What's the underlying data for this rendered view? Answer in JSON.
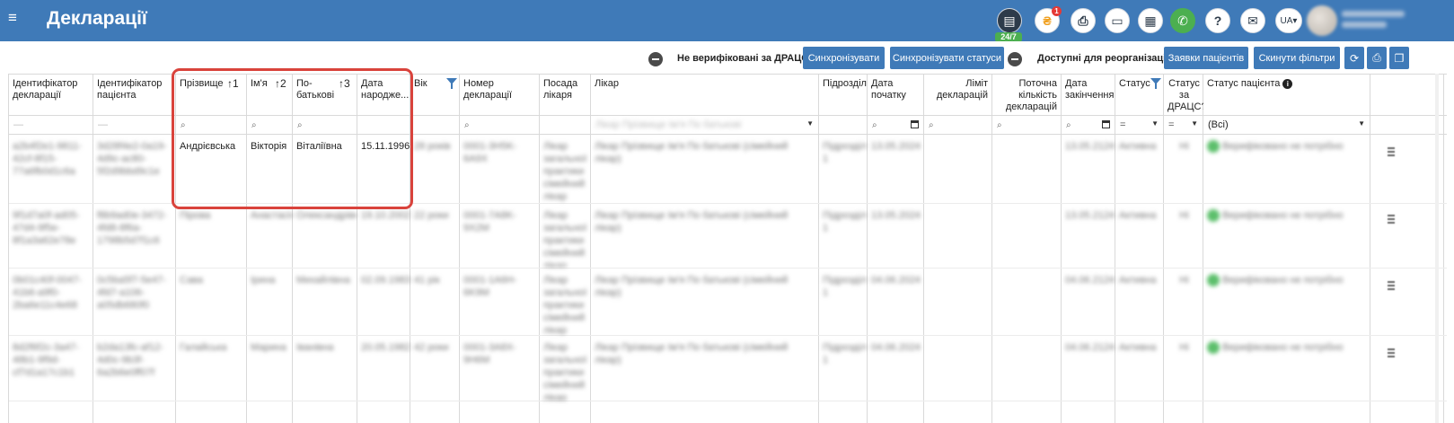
{
  "header": {
    "menu_icon": "hamburger-icon",
    "title": "Декларації",
    "chat_badge": "24/7",
    "notif_badge": "1",
    "lang": "UA▾",
    "icons": [
      "chat-icon",
      "notification-icon",
      "pdf-icon",
      "card-icon",
      "calculator-icon",
      "phone-icon",
      "help-icon",
      "megaphone-icon"
    ]
  },
  "toolbar": {
    "not_verified_label": "Не верифіковані за ДРАЦС",
    "sync_btn": "Синхронізувати",
    "sync_status_btn": "Синхронізувати статуси",
    "reorg_label": "Доступні для реорганізації",
    "requests_btn": "Заявки пацієнтів",
    "reset_filters_btn": "Скинути фільтри",
    "icons": [
      "refresh-icon",
      "print-icon",
      "copy-icon"
    ]
  },
  "columns": {
    "decl_id": "Ідентифікатор декларації",
    "patient_id": "Ідентифікатор пацієнта",
    "surname": "Прізвище",
    "surname_sort": "↑1",
    "name": "Ім'я",
    "name_sort": "↑2",
    "patronymic": "По-батькові",
    "patronymic_sort": "↑3",
    "birth_date": "Дата народже...",
    "age": "Вік",
    "decl_number": "Номер декларації",
    "doctor_position": "Посада лікаря",
    "doctor": "Лікар",
    "division": "Підрозділ",
    "start_date": "Дата початку",
    "decl_limit": "Ліміт декларацій",
    "current_count": "Поточна кількість декларацій",
    "end_date": "Дата закінчення",
    "status": "Статус",
    "dracs_status": "Статус за ДРАЦС?",
    "patient_status": "Статус пацієнта"
  },
  "filters": {
    "search_mark": "⌕",
    "eq": "=",
    "all": "(Всі)",
    "doctor_placeholder": "Лікар Прізвище Ім'я По батькові"
  },
  "rows": [
    {
      "decl_id": "a2b4f2e1-9811-42cf-8f15-77a6fb0d1c6a",
      "patient_id": "3d28f4e2-0a19-4d9c-ac80-5f2d9bbd9c1e",
      "surname": "Андрієвська",
      "name": "Вікторія",
      "patronymic": "Віталіївна",
      "birth_date": "15.11.1996",
      "age": "28 років",
      "decl_number": "0001-3H5K-6A9X",
      "doctor_position": "Лікар загальної практики сімейний лікар",
      "doctor": "Лікар Прізвище Ім'я По батькові (сімейний лікар)",
      "division": "Підрозділ 1",
      "start_date": "13.05.2024",
      "end_date": "13.05.2124",
      "status": "Активна",
      "dracs": "Ні",
      "patient_status": "Верифіковано не потрібно"
    },
    {
      "decl_id": "9f1d7a0f-ad05-47d4-9f5e-8f1a3a62e78e",
      "patient_id": "f8b9ad0e-3472-4fd8-8f6a-1798b5d7f1c6",
      "surname": "Пірова",
      "name": "Анастасія",
      "patronymic": "Олександрівна",
      "birth_date": "19.10.2002",
      "age": "22 роки",
      "decl_number": "0001-7A8K-9X2M",
      "doctor_position": "Лікар загальної практики сімейний лікар",
      "doctor": "Лікар Прізвище Ім'я По батькові (сімейний лікар)",
      "division": "Підрозділ 1",
      "start_date": "13.05.2024",
      "end_date": "13.05.2124",
      "status": "Активна",
      "dracs": "Ні",
      "patient_status": "Верифіковано не потрібно"
    },
    {
      "decl_id": "0b01c40f-0047-41b6-a9f0-2ba6e11c4e68",
      "patient_id": "0c5ba5f7-5e47-4fd7-a106-a05db680f0",
      "surname": "Сава",
      "name": "Ірина",
      "patronymic": "Михайлівна",
      "birth_date": "02.09.1983",
      "age": "41 рік",
      "decl_number": "0001-1A6H-6K9M",
      "doctor_position": "Лікар загальної практики сімейний лікар",
      "doctor": "Лікар Прізвище Ім'я По батькові (сімейний лікар)",
      "division": "Підрозділ 1",
      "start_date": "04.06.2024",
      "end_date": "04.06.2124",
      "status": "Активна",
      "dracs": "Ні",
      "patient_status": "Верифіковано не потрібно"
    },
    {
      "decl_id": "8d2f6f2c-3a47-48b1-9f9d-cf7d1a17c1b1",
      "patient_id": "b2da13fc-af12-4d0c-9b3f-6a2b6e0ff07f",
      "surname": "Галайська",
      "name": "Марина",
      "patronymic": "Іванівна",
      "birth_date": "20.05.1982",
      "age": "42 роки",
      "decl_number": "0001-3A8X-9H6M",
      "doctor_position": "Лікар загальної практики сімейний лікар (ГП)",
      "doctor": "Лікар Прізвище Ім'я По батькові (сімейний лікар)",
      "division": "Підрозділ 1",
      "start_date": "04.06.2024",
      "end_date": "04.06.2124",
      "status": "Активна",
      "dracs": "Ні",
      "patient_status": "Верифіковано не потрібно"
    }
  ]
}
